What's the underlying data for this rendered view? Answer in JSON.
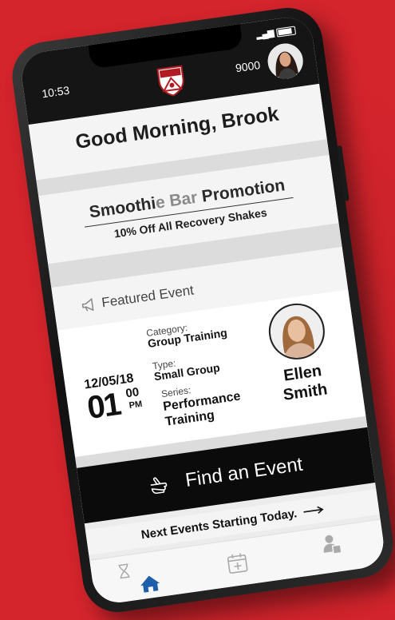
{
  "status": {
    "time": "10:53"
  },
  "header": {
    "points": "9000"
  },
  "greeting": "Good Morning, Brook",
  "promotion": {
    "title_prefix": "Smoothi",
    "title_highlight": "e Bar",
    "title_suffix": " Promotion",
    "subtitle": "10% Off All Recovery Shakes"
  },
  "featured": {
    "heading": "Featured Event",
    "date": "12/05/18",
    "hour": "01",
    "minute": "00",
    "ampm": "PM",
    "category_label": "Category:",
    "category_value": "Group Training",
    "type_label": "Type:",
    "type_value": "Small Group",
    "series_label": "Series:",
    "series_value_1": "Performance",
    "series_value_2": "Training",
    "host_first": "Ellen",
    "host_last": "Smith"
  },
  "actions": {
    "find_event": "Find an Event",
    "next_events": "Next Events Starting Today."
  },
  "tabs": [
    "home-icon",
    "calendar-add-icon",
    "profile-icon"
  ],
  "colors": {
    "background": "#d4242c",
    "accent": "#1d4d8a",
    "dark": "#0b0b0b"
  }
}
